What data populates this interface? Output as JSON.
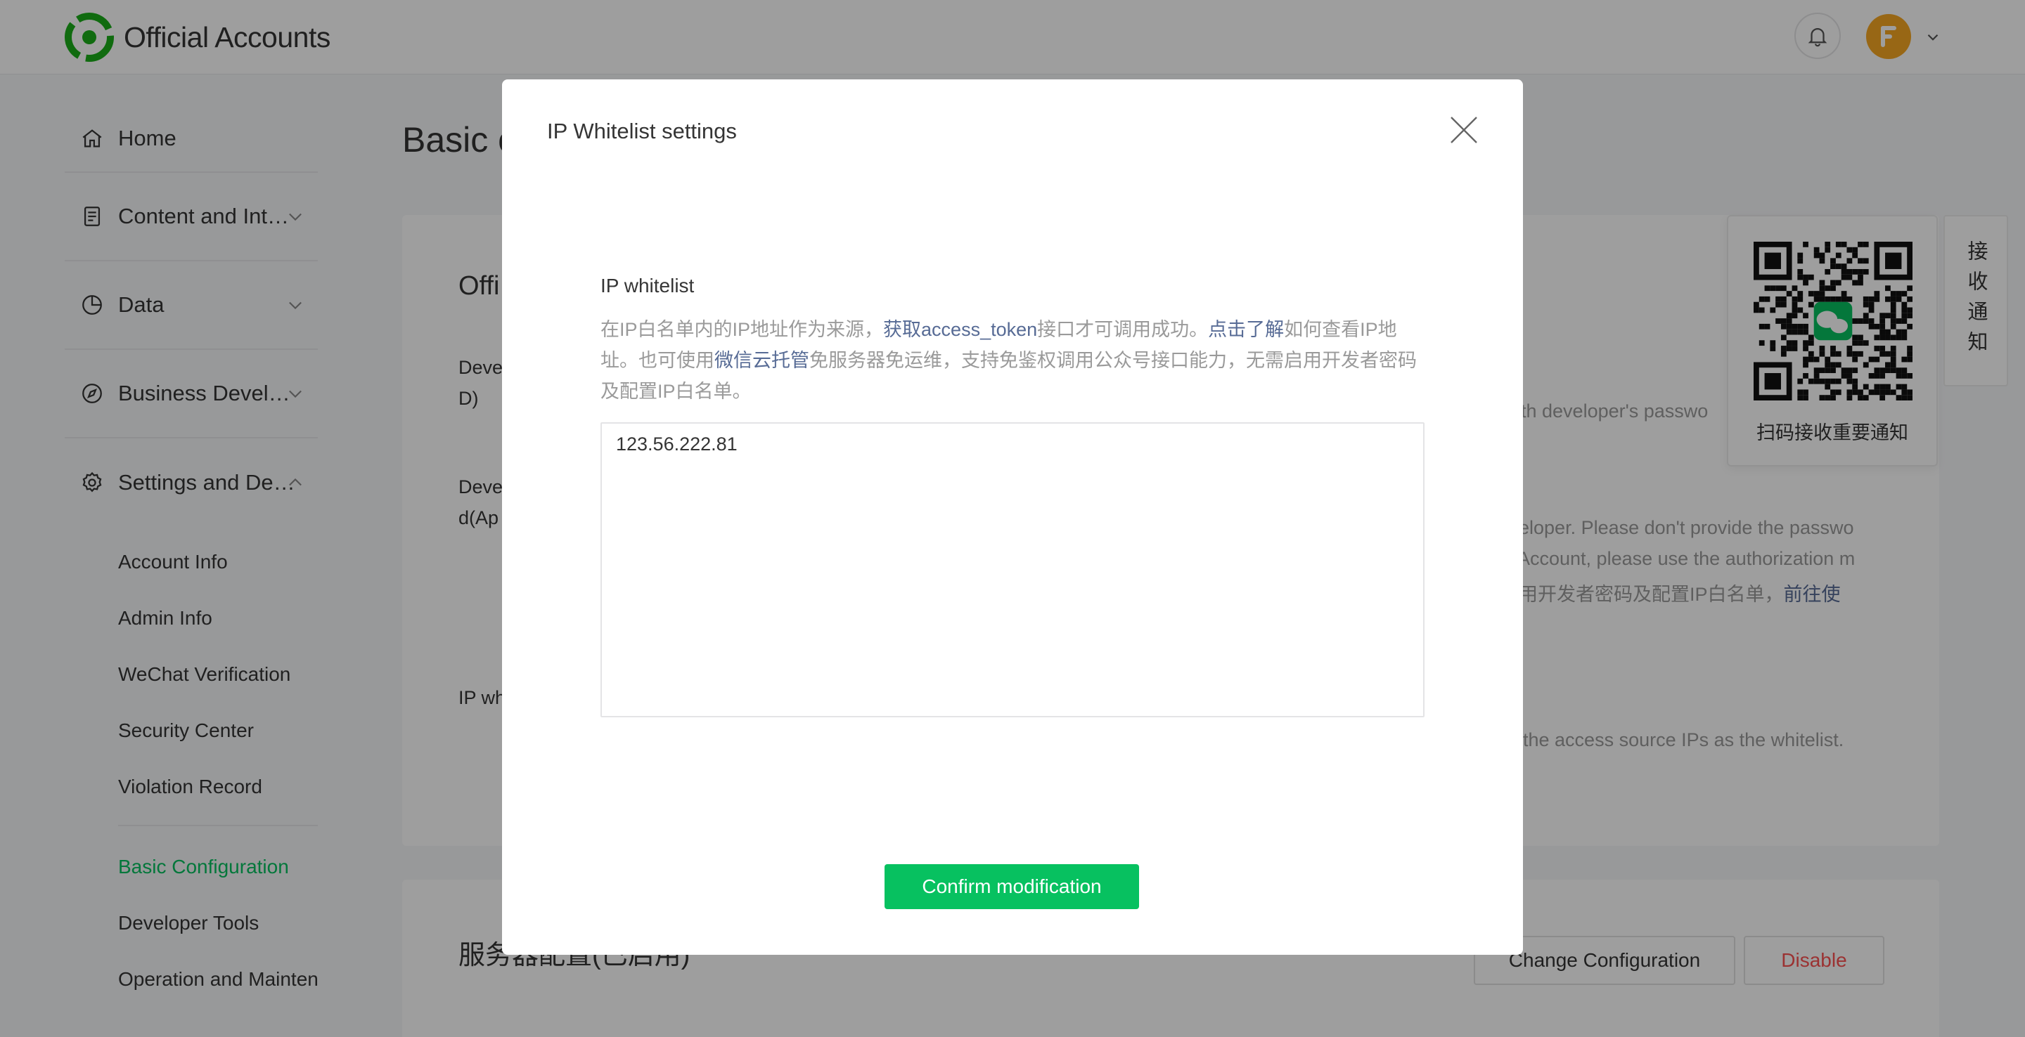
{
  "header": {
    "app_name": "Official Accounts",
    "icons": [
      "wechat-logo",
      "bell-icon",
      "avatar",
      "chevron-down-icon"
    ]
  },
  "sidebar": {
    "items": [
      {
        "label": "Home",
        "icon": "home-icon"
      },
      {
        "label": "Content and Interaction",
        "icon": "document-icon"
      },
      {
        "label": "Data",
        "icon": "pie-chart-icon"
      },
      {
        "label": "Business Development",
        "icon": "compass-icon"
      },
      {
        "label": "Settings and Development",
        "icon": "gear-icon"
      }
    ],
    "sub_items_group1": [
      "Account Info",
      "Admin Info",
      "WeChat Verification",
      "Security Center",
      "Violation Record"
    ],
    "sub_items_group2": [
      "Basic Configuration",
      "Developer Tools",
      "Operation and Maintenance Center"
    ],
    "active_item": "Basic Configuration"
  },
  "main": {
    "page_title": "Basic c",
    "section_title": "Offi",
    "row1_label_a": "Deve",
    "row1_label_b": "D)",
    "row2_label_a": "Deve",
    "row2_label_b": "d(Ap",
    "row3_label": "IP wh",
    "right_text_1": "l with developer's passwo",
    "right_text_2": "eloper. Please don't provide the passwo",
    "right_text_3": "Account, please use the authorization m",
    "right_text_4": "用开发者密码及配置IP白名单，",
    "right_link_4": "前往使",
    "right_text_5": "the access source IPs as the whitelist.",
    "server_config_title": "服务器配置(已启用)",
    "change_config_button": "Change Configuration",
    "disable_button": "Disable"
  },
  "qr_notice": {
    "caption": "扫码接收重要通知",
    "side_tab": "接收通知"
  },
  "modal": {
    "title": "IP Whitelist settings",
    "field_label": "IP whitelist",
    "desc_1": "在IP白名单内的IP地址作为来源，",
    "desc_link_1": "获取access_token",
    "desc_2": "接口才可调用成功。",
    "desc_link_2": "点击了解",
    "desc_3": "如何查看IP地址。也可使用",
    "desc_link_3": "微信云托管",
    "desc_4": "免服务器免运维，支持免鉴权调用公众号接口能力，无需启用开发者密码及配置IP白名单。",
    "ip_value": "123.56.222.81",
    "confirm_button": "Confirm modification"
  },
  "colors": {
    "brand_green": "#07c160",
    "link_blue": "#576b95",
    "danger_red": "#fa5151",
    "avatar_orange": "#f5a623"
  }
}
